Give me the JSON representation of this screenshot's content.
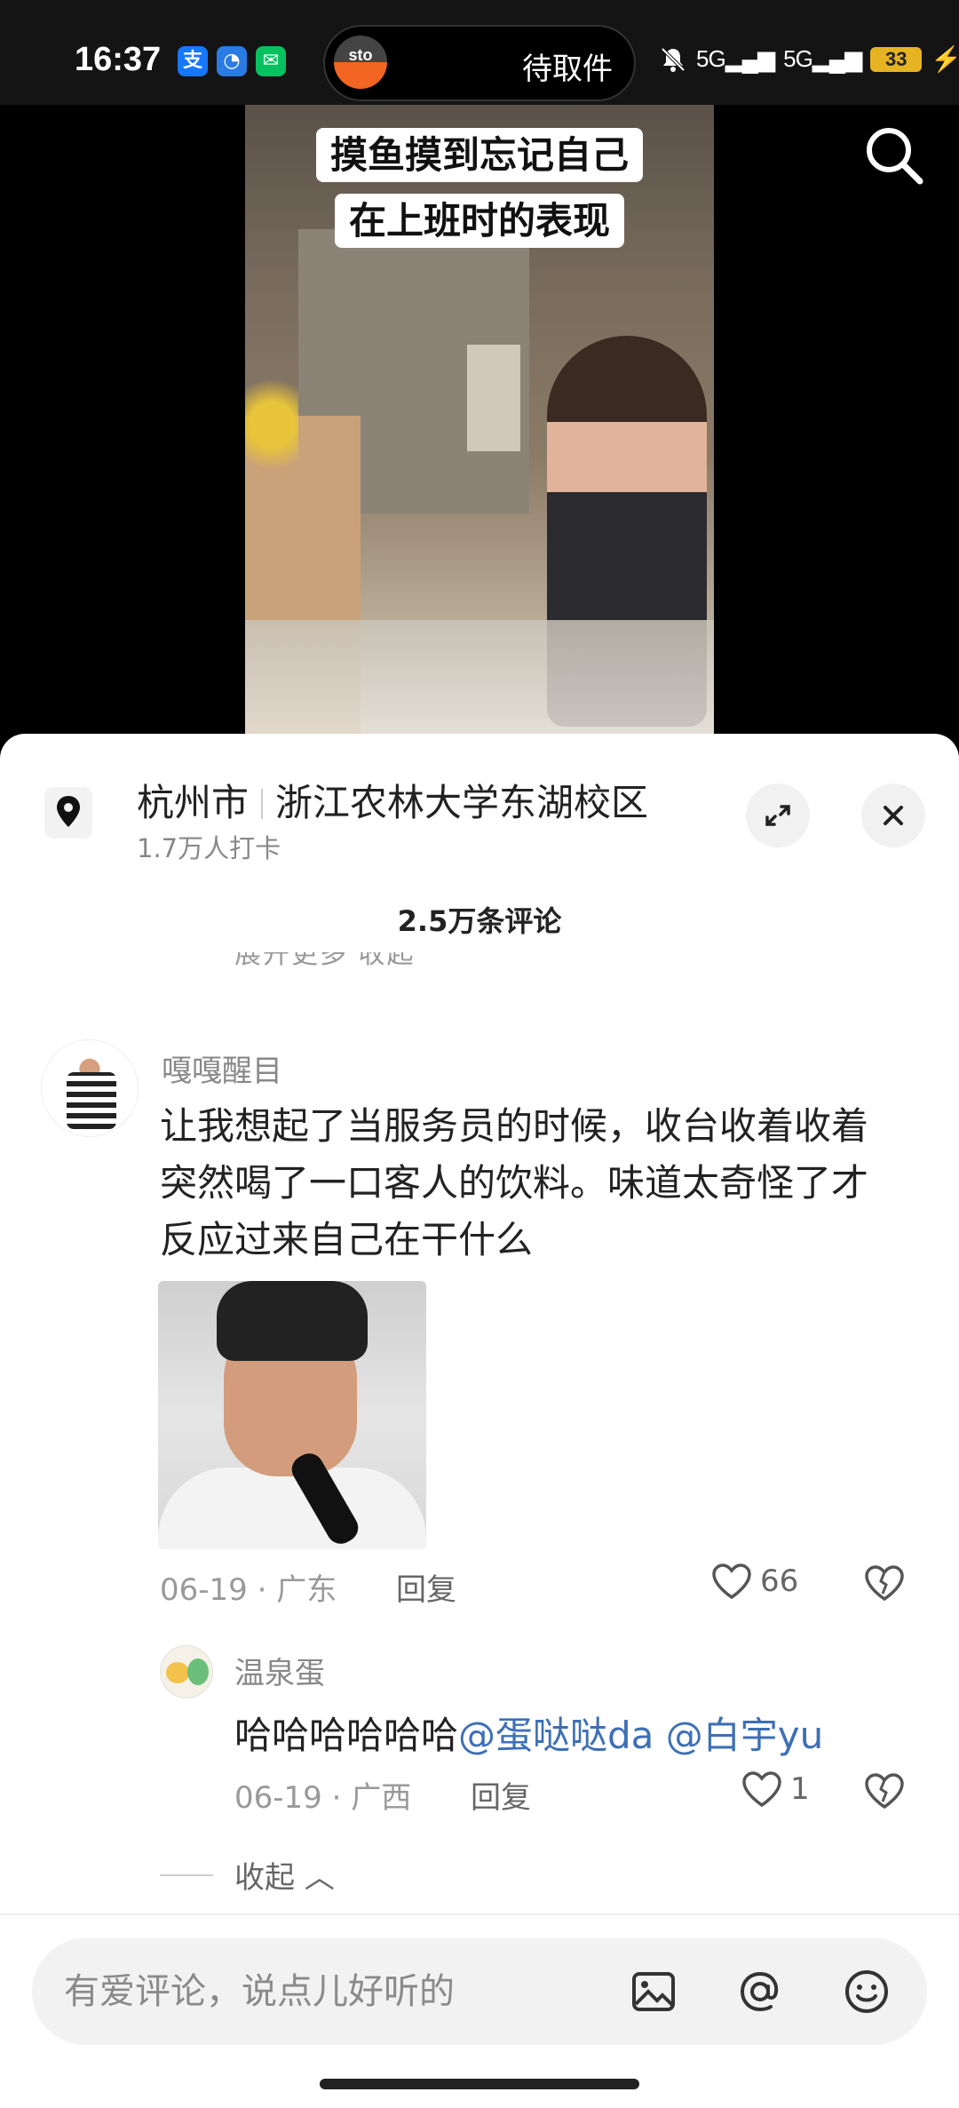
{
  "status_bar": {
    "time": "16:37",
    "pill_text": "待取件",
    "pill_logo": "sto",
    "signal_1": "5G",
    "signal_2": "5G",
    "battery": "33"
  },
  "video": {
    "caption_line1": "摸鱼摸到忘记自己",
    "caption_line2": "在上班时的表现"
  },
  "location": {
    "city": "杭州市",
    "place": "浙江农林大学东湖校区",
    "checkins": "1.7万人打卡"
  },
  "comments_header": {
    "count": "2.5万条评论",
    "ghost_row": "展开更多      收起"
  },
  "comment": {
    "username": "嘎嘎醒目",
    "text": "让我想起了当服务员的时候，收台收着收着突然喝了一口客人的饮料。味道太奇怪了才反应过来自己在干什么",
    "meta": "06-19 · 广东",
    "reply_label": "回复",
    "likes": "66"
  },
  "reply": {
    "username": "温泉蛋",
    "text_plain": "哈哈哈哈哈哈",
    "mention1": "@蛋哒哒da",
    "mention2": "@白宇yu",
    "meta": "06-19 · 广西",
    "reply_label": "回复",
    "likes": "1"
  },
  "collapse_label": "收起",
  "input": {
    "placeholder": "有爱评论，说点儿好听的"
  },
  "colors": {
    "mention": "#3d6fb6",
    "battery": "#e6b422",
    "sto_orange": "#f26522"
  }
}
